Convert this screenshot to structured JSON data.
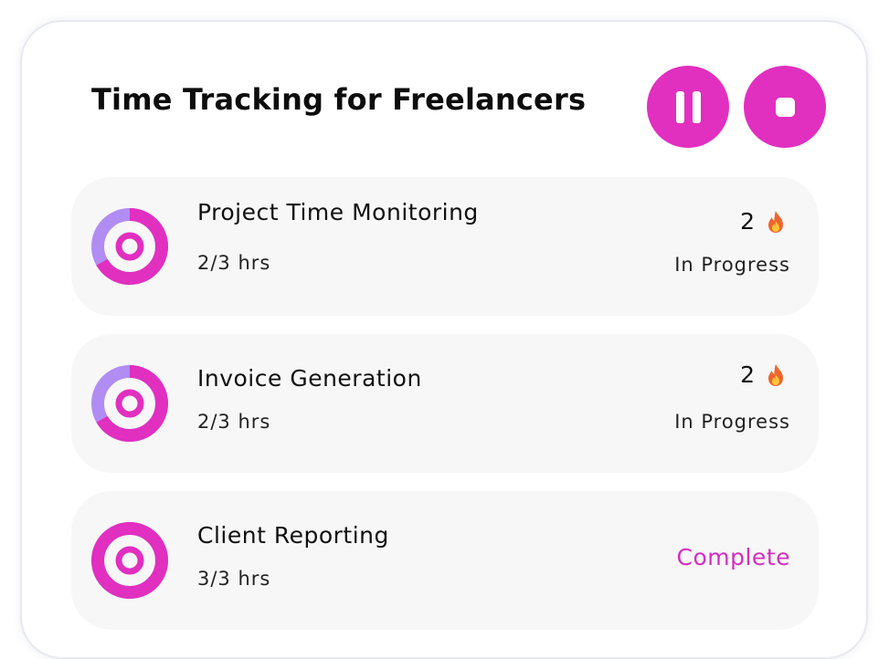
{
  "header": {
    "title": "Time Tracking for Freelancers",
    "pause_icon": "pause-icon",
    "stop_icon": "stop-icon"
  },
  "colors": {
    "accent": "#e12fc0",
    "progress_remaining": "#b18cf2",
    "complete_text": "#d52ec0",
    "card_background": "#f7f7f7"
  },
  "tasks": [
    {
      "name": "Project Time Monitoring",
      "hours": "2/3 hrs",
      "progress": 0.6667,
      "streak": "2",
      "streak_icon": "fire-icon",
      "status": "In Progress"
    },
    {
      "name": "Invoice Generation",
      "hours": "2/3 hrs",
      "progress": 0.6667,
      "streak": "2",
      "streak_icon": "fire-icon",
      "status": "In Progress"
    },
    {
      "name": "Client Reporting",
      "hours": "3/3 hrs",
      "progress": 1.0,
      "streak": "",
      "streak_icon": "",
      "status": "Complete"
    }
  ]
}
